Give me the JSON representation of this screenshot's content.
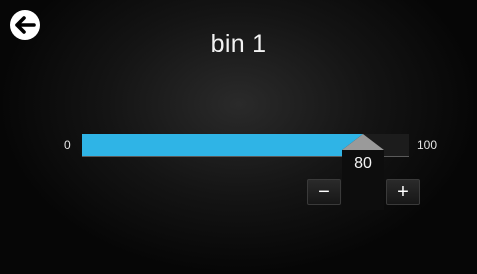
{
  "header": {
    "title": "bin 1",
    "back_icon": "arrow-left-circle-icon"
  },
  "slider": {
    "min_label": "0",
    "max_label": "100",
    "value": 80,
    "value_text": "80",
    "fill_fraction": 0.86,
    "accent_color": "#2fb4e6"
  },
  "stepper": {
    "minus_label": "−",
    "plus_label": "+"
  }
}
